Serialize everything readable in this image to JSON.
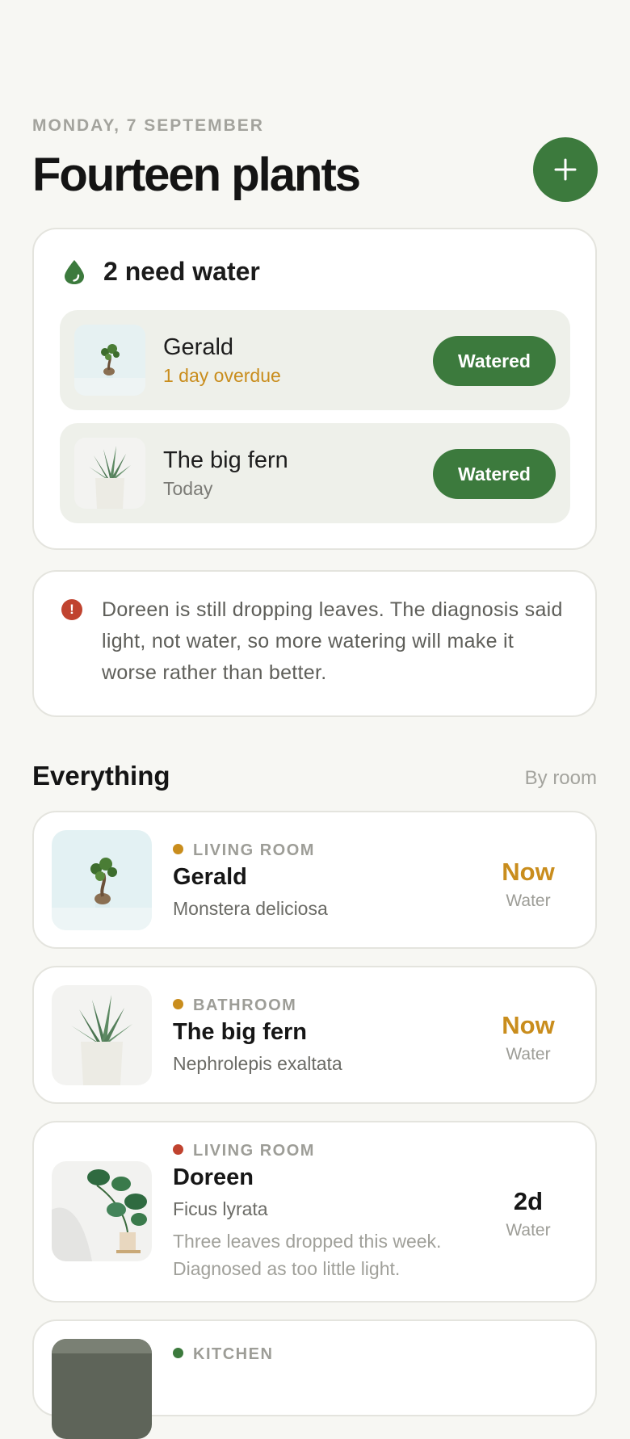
{
  "header": {
    "date": "MONDAY, 7 SEPTEMBER",
    "title": "Fourteen plants",
    "add_icon": "plus-icon"
  },
  "water_summary": {
    "title": "2 need water",
    "icon": "water-drop-icon",
    "tasks": [
      {
        "name": "Gerald",
        "status": "1 day overdue",
        "button": "Watered"
      },
      {
        "name": "The big fern",
        "status": "Today",
        "button": "Watered"
      }
    ]
  },
  "alert": {
    "icon": "alert-icon",
    "icon_glyph": "!",
    "text": "Doreen is still dropping leaves. The diagnosis said light, not water, so more watering will make it worse rather than better."
  },
  "section": {
    "title": "Everything",
    "sort": "By room"
  },
  "plants": [
    {
      "room": "LIVING ROOM",
      "room_color": "#c98d1d",
      "name": "Gerald",
      "species": "Monstera deliciosa",
      "note": "",
      "due": "Now",
      "due_label": "Water"
    },
    {
      "room": "BATHROOM",
      "room_color": "#c98d1d",
      "name": "The big fern",
      "species": "Nephrolepis exaltata",
      "note": "",
      "due": "Now",
      "due_label": "Water"
    },
    {
      "room": "LIVING ROOM",
      "room_color": "#c0432f",
      "name": "Doreen",
      "species": "Ficus lyrata",
      "note": "Three leaves dropped this week. Diagnosed as too little light.",
      "due": "2d",
      "due_label": "Water"
    },
    {
      "room": "KITCHEN",
      "room_color": "#3c7a3d",
      "name": "",
      "species": "",
      "note": "",
      "due": "",
      "due_label": ""
    }
  ],
  "colors": {
    "background": "#f7f7f3",
    "accent_green": "#3c7a3d",
    "overdue_amber": "#c98d1d",
    "alert_red": "#c0432f"
  }
}
